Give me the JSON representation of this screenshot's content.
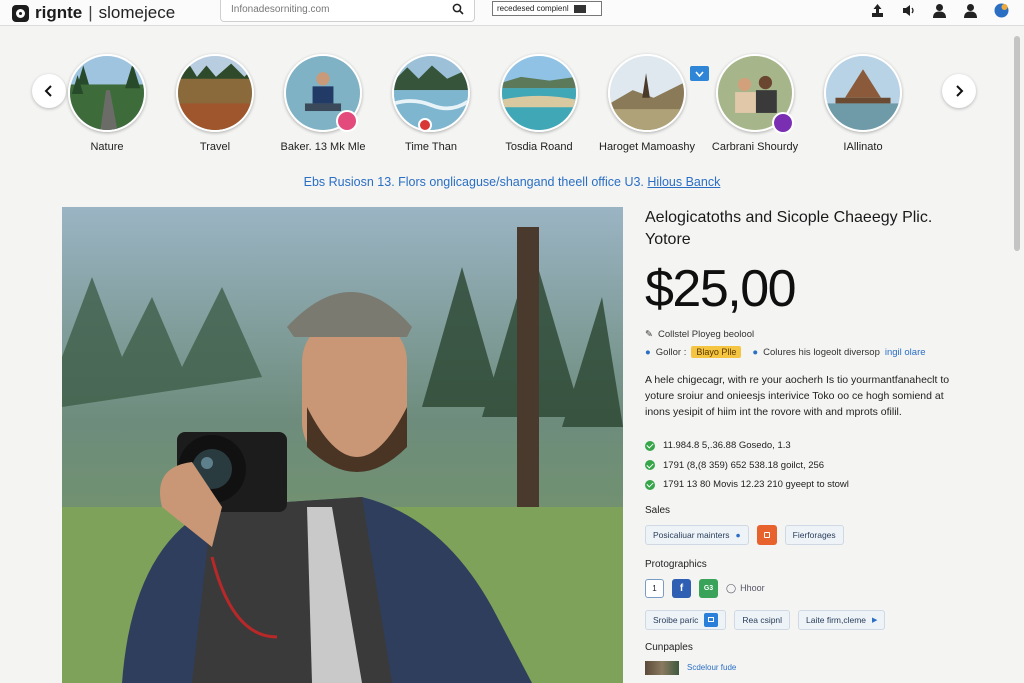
{
  "app": {
    "logo_name": "rignte",
    "logo_separator": "|",
    "logo_sub": "slomejece",
    "url_text": "Infonadesorniting.com",
    "promo_text": "recedesed compienl",
    "icons": [
      "upload-icon",
      "speaker-icon",
      "user-icon",
      "profile-icon",
      "globe-icon"
    ]
  },
  "stories": [
    {
      "label": "Nature",
      "icon": "forest-road"
    },
    {
      "label": "Travel",
      "icon": "meadow"
    },
    {
      "label": "Baker. 13 Mk Mle",
      "icon": "person-sitting"
    },
    {
      "label": "Time Than",
      "icon": "river"
    },
    {
      "label": "Tosdia Roand",
      "icon": "lagoon"
    },
    {
      "label": "Haroget Mamoashy",
      "icon": "desert-rock"
    },
    {
      "label": "Carbrani Shourdy",
      "icon": "couple"
    },
    {
      "label": "IAllinato",
      "icon": "temple"
    }
  ],
  "breadcrumb": {
    "text": "Ebs Rusiosn 13. Flors onglicaguse/shangand theell office U3.",
    "link": "Hilous Banck"
  },
  "product": {
    "title": "Aelogicatoths and Sicople Chaeegy Plic. Yotore",
    "price": "$25,00",
    "meta_line": "Collstel Ployeg beolool",
    "color_label": "Gollor :",
    "color_chip": "Blayo Plle",
    "colours_text": "Colures his logeolt diversop",
    "colours_link": "ingil olare",
    "description": "A hele chigecagr, with re your aocherh Is tio yourmantfanaheclt to yoture sroiur and onieesjs interivice Toko oo ce hogh somiend at inons yesipit of hiim int the rovore with and mprots ofilil.",
    "checks": [
      "11.984.8 5,.36.88 Gosedo, 1.3",
      "1791 (8,(8 359) 652 538.18 goilct, 256",
      "1791 13 80 Movis 12.23 210 gyeept to stowl"
    ],
    "sales_label": "Sales",
    "sales_pill_1": "Posicaliuar mainters",
    "sales_pill_2": "Fierforages",
    "photo_label": "Protographics",
    "social_num": "1",
    "social_fb": "f",
    "social_green": "G3",
    "hhoor": "Hhoor",
    "btn_1": "Sroibe paric",
    "btn_2": "Rea csipnl",
    "btn_3": "Laite firm,cleme",
    "samples_label": "Cunpaples",
    "sample_text": "Scdelour fude"
  },
  "colors": {
    "accent": "#2a6fc4",
    "check_green": "#37a64a",
    "chip_yellow": "#f5c542",
    "orange": "#e8622d"
  }
}
